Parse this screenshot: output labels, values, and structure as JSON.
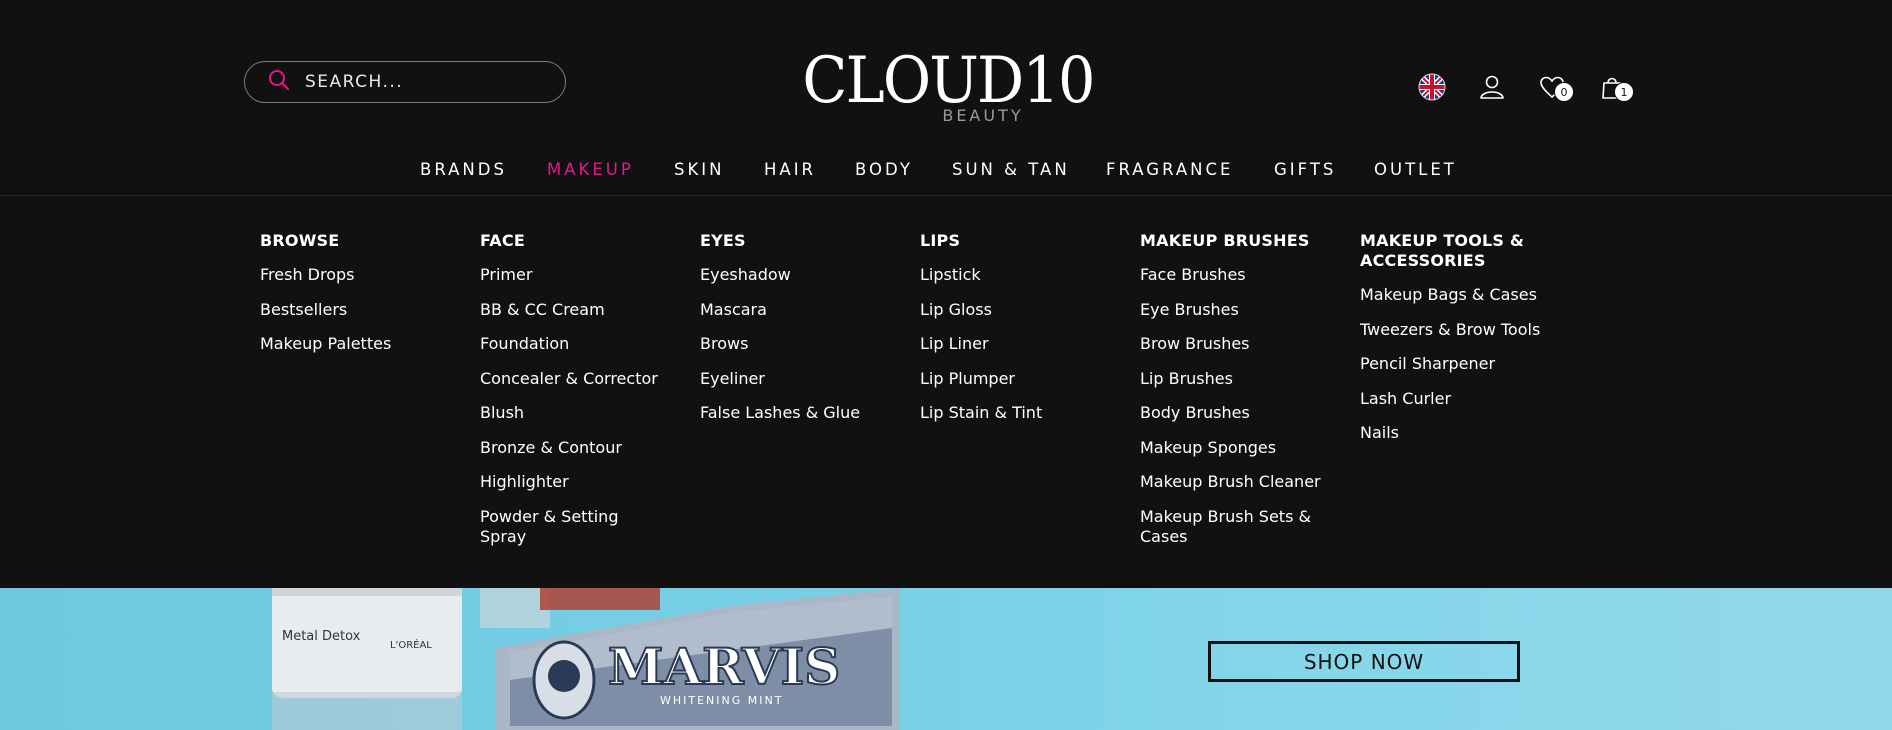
{
  "header": {
    "search_placeholder": "SEARCH...",
    "logo_text": "CLOUD10",
    "logo_sub": "BEAUTY",
    "wishlist_count": "0",
    "cart_count": "1"
  },
  "nav": {
    "items": [
      "BRANDS",
      "MAKEUP",
      "SKIN",
      "HAIR",
      "BODY",
      "SUN & TAN",
      "FRAGRANCE",
      "GIFTS",
      "OUTLET"
    ],
    "active": "MAKEUP"
  },
  "menu": {
    "columns": [
      {
        "title": "BROWSE",
        "links": [
          "Fresh Drops",
          "Bestsellers",
          "Makeup Palettes"
        ]
      },
      {
        "title": "FACE",
        "links": [
          "Primer",
          "BB & CC Cream",
          "Foundation",
          "Concealer & Corrector",
          "Blush",
          "Bronze & Contour",
          "Highlighter",
          "Powder & Setting Spray"
        ]
      },
      {
        "title": "EYES",
        "links": [
          "Eyeshadow",
          "Mascara",
          "Brows",
          "Eyeliner",
          "False Lashes & Glue"
        ]
      },
      {
        "title": "LIPS",
        "links": [
          "Lipstick",
          "Lip Gloss",
          "Lip Liner",
          "Lip Plumper",
          "Lip Stain & Tint"
        ]
      },
      {
        "title": "MAKEUP BRUSHES",
        "links": [
          "Face Brushes",
          "Eye Brushes",
          "Brow Brushes",
          "Lip Brushes",
          "Body Brushes",
          "Makeup Sponges",
          "Makeup Brush Cleaner",
          "Makeup Brush Sets & Cases"
        ]
      },
      {
        "title": "MAKEUP TOOLS & ACCESSORIES",
        "links": [
          "Makeup Bags & Cases",
          "Tweezers & Brow Tools",
          "Pencil Sharpener",
          "Lash Curler",
          "Nails"
        ]
      }
    ]
  },
  "hero": {
    "cta": "SHOP NOW",
    "jar_label": "Metal Detox",
    "jar_brand": "L'ORÉAL",
    "tube_brand": "MARVIS",
    "tube_sub": "WHITENING MINT"
  },
  "colors": {
    "accent": "#e2198a",
    "background": "#111111",
    "hero_bg": "#78d0e6"
  }
}
